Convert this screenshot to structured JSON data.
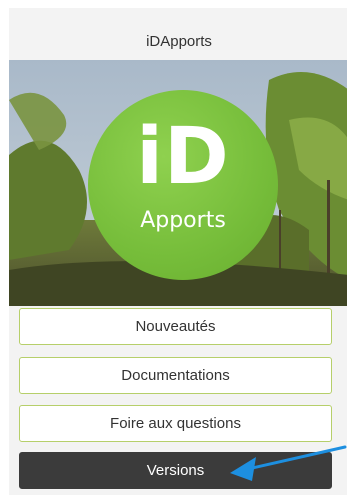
{
  "header": {
    "title": "iDApports"
  },
  "logo": {
    "mark": "iD",
    "subtitle": "Apports",
    "accent": "#76bd3a"
  },
  "menu": {
    "items": [
      {
        "label": "Nouveautés",
        "active": false
      },
      {
        "label": "Documentations",
        "active": false
      },
      {
        "label": "Foire aux questions",
        "active": false
      },
      {
        "label": "Versions",
        "active": true
      }
    ]
  },
  "annotation": {
    "icon": "arrow-icon",
    "color": "#1d8fe0"
  }
}
